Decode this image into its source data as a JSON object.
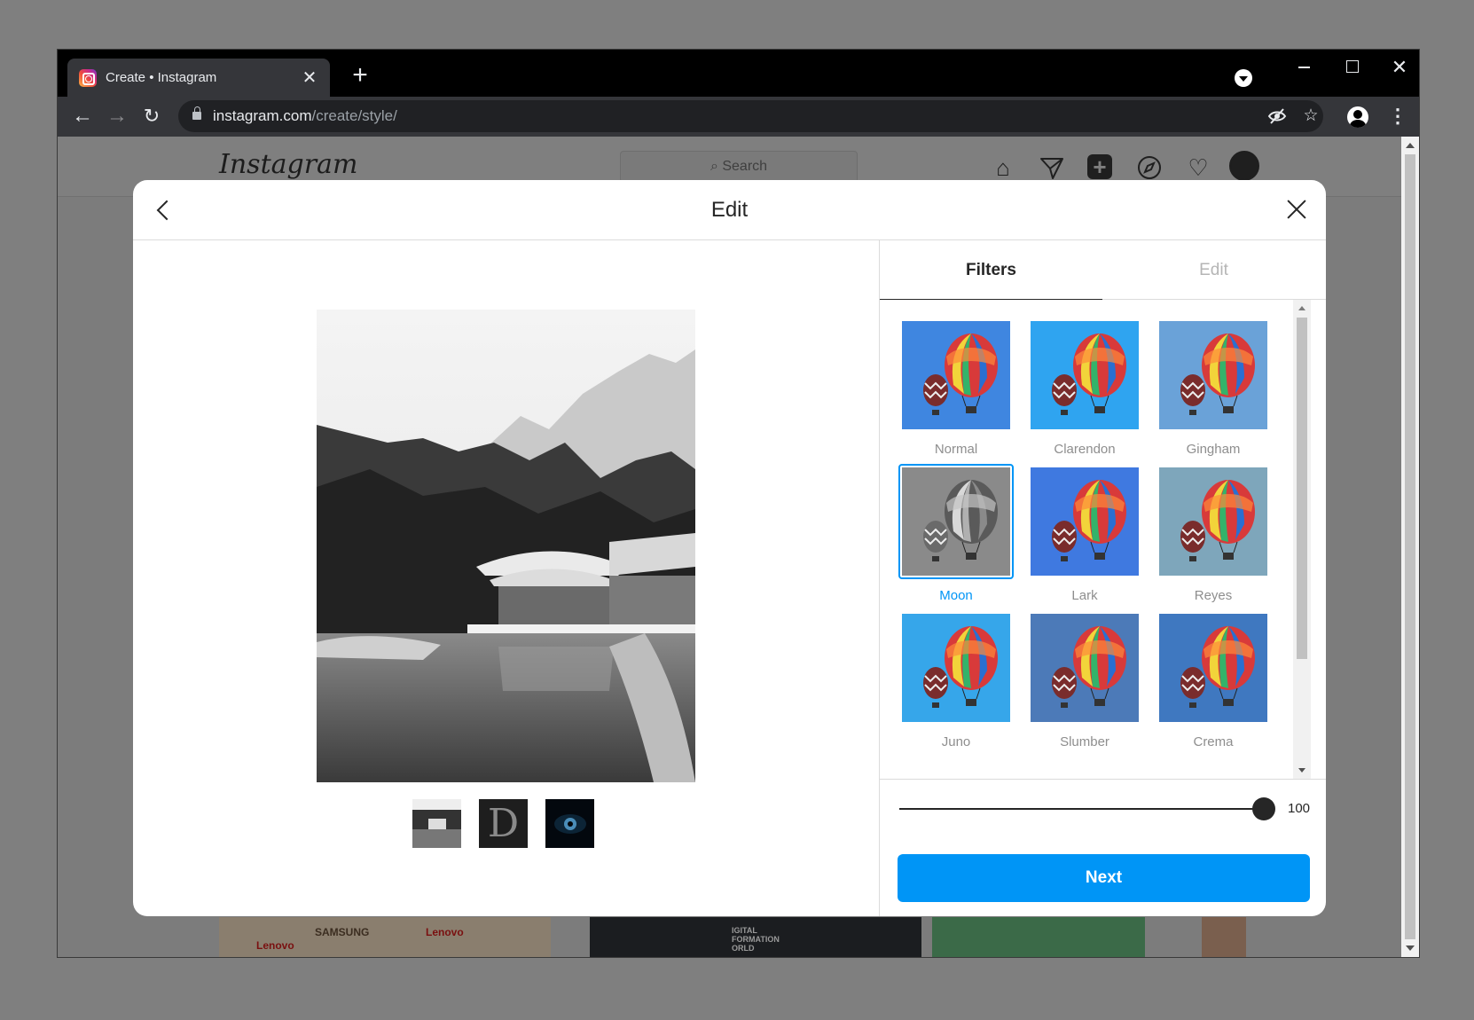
{
  "browser": {
    "tab_title": "Create • Instagram",
    "tab_close": "✕",
    "new_tab": "+",
    "url_host": "instagram.com",
    "url_path": "/create/style/",
    "icons": [
      "back-arrow-icon",
      "forward-arrow-icon",
      "reload-icon",
      "lock-icon",
      "eye-off-icon",
      "star-icon",
      "profile-icon",
      "menu-icon"
    ]
  },
  "instagram": {
    "logo": "Instagram",
    "search_placeholder": "Search"
  },
  "background_feed": {
    "labels": [
      "SAMSUNG",
      "Lenovo",
      "Lenovo",
      "IGITAL FORMATION ORLD"
    ]
  },
  "modal": {
    "title": "Edit",
    "tabs": {
      "filters": "Filters",
      "edit": "Edit"
    },
    "filters": [
      {
        "name": "Normal",
        "sky": "#3f86e0"
      },
      {
        "name": "Clarendon",
        "sky": "#2fa4f0"
      },
      {
        "name": "Gingham",
        "sky": "#6aa2d8"
      },
      {
        "name": "Moon",
        "sky": "#8a8a8a",
        "selected": true
      },
      {
        "name": "Lark",
        "sky": "#3f79e0"
      },
      {
        "name": "Reyes",
        "sky": "#7ea6bb"
      },
      {
        "name": "Juno",
        "sky": "#36a6ea"
      },
      {
        "name": "Slumber",
        "sky": "#4c7ab8"
      },
      {
        "name": "Crema",
        "sky": "#3f78c0"
      }
    ],
    "selected_filter": "Moon",
    "intensity": 100,
    "intensity_label": "100",
    "next_label": "Next",
    "accent": "#0095f6"
  }
}
